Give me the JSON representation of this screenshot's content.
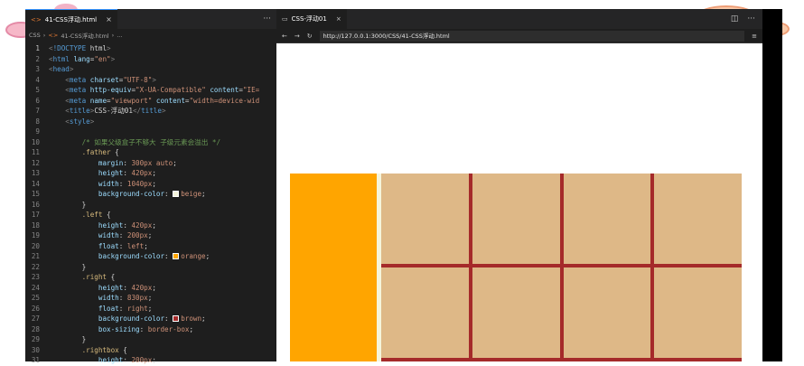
{
  "editor": {
    "tab_label": "41-CSS浮动.html",
    "breadcrumb": [
      "CSS",
      "41-CSS浮动.html",
      "..."
    ],
    "more": "···",
    "close": "×",
    "active_line": 1,
    "lines": [
      {
        "n": 1,
        "t": [
          [
            "pun",
            "<"
          ],
          [
            "kw",
            "!DOCTYPE"
          ],
          [
            "txt",
            " html"
          ],
          [
            "pun",
            ">"
          ]
        ]
      },
      {
        "n": 2,
        "t": [
          [
            "pun",
            "<"
          ],
          [
            "tag",
            "html"
          ],
          [
            "at",
            " lang"
          ],
          [
            "txt",
            "="
          ],
          [
            "str",
            "\"en\""
          ],
          [
            "pun",
            ">"
          ]
        ]
      },
      {
        "n": 3,
        "t": [
          [
            "pun",
            "<"
          ],
          [
            "tag",
            "head"
          ],
          [
            "pun",
            ">"
          ]
        ]
      },
      {
        "n": 4,
        "t": [
          [
            "txt",
            "    "
          ],
          [
            "pun",
            "<"
          ],
          [
            "tag",
            "meta"
          ],
          [
            "at",
            " charset"
          ],
          [
            "txt",
            "="
          ],
          [
            "str",
            "\"UTF-8\""
          ],
          [
            "pun",
            ">"
          ]
        ]
      },
      {
        "n": 5,
        "t": [
          [
            "txt",
            "    "
          ],
          [
            "pun",
            "<"
          ],
          [
            "tag",
            "meta"
          ],
          [
            "at",
            " http-equiv"
          ],
          [
            "txt",
            "="
          ],
          [
            "str",
            "\"X-UA-Compatible\""
          ],
          [
            "at",
            " content"
          ],
          [
            "txt",
            "="
          ],
          [
            "str",
            "\"IE="
          ]
        ]
      },
      {
        "n": 6,
        "t": [
          [
            "txt",
            "    "
          ],
          [
            "pun",
            "<"
          ],
          [
            "tag",
            "meta"
          ],
          [
            "at",
            " name"
          ],
          [
            "txt",
            "="
          ],
          [
            "str",
            "\"viewport\""
          ],
          [
            "at",
            " content"
          ],
          [
            "txt",
            "="
          ],
          [
            "str",
            "\"width=device-wid"
          ]
        ]
      },
      {
        "n": 7,
        "t": [
          [
            "txt",
            "    "
          ],
          [
            "pun",
            "<"
          ],
          [
            "tag",
            "title"
          ],
          [
            "pun",
            ">"
          ],
          [
            "txt",
            "CSS-浮动01"
          ],
          [
            "pun",
            "</"
          ],
          [
            "tag",
            "title"
          ],
          [
            "pun",
            ">"
          ]
        ]
      },
      {
        "n": 8,
        "t": [
          [
            "txt",
            "    "
          ],
          [
            "pun",
            "<"
          ],
          [
            "tag",
            "style"
          ],
          [
            "pun",
            ">"
          ]
        ]
      },
      {
        "n": 9,
        "t": []
      },
      {
        "n": 10,
        "t": [
          [
            "txt",
            "        "
          ],
          [
            "cmt",
            "/* 如果父级盒子不够大 子级元素会溢出 */"
          ]
        ]
      },
      {
        "n": 11,
        "t": [
          [
            "txt",
            "        "
          ],
          [
            "sel",
            ".father"
          ],
          [
            "txt",
            " {"
          ]
        ]
      },
      {
        "n": 12,
        "t": [
          [
            "txt",
            "            "
          ],
          [
            "prop",
            "margin"
          ],
          [
            "txt",
            ": "
          ],
          [
            "val",
            "300px auto"
          ],
          [
            "txt",
            ";"
          ]
        ]
      },
      {
        "n": 13,
        "t": [
          [
            "txt",
            "            "
          ],
          [
            "prop",
            "height"
          ],
          [
            "txt",
            ": "
          ],
          [
            "val",
            "420px"
          ],
          [
            "txt",
            ";"
          ]
        ]
      },
      {
        "n": 14,
        "t": [
          [
            "txt",
            "            "
          ],
          [
            "prop",
            "width"
          ],
          [
            "txt",
            ": "
          ],
          [
            "val",
            "1040px"
          ],
          [
            "txt",
            ";"
          ]
        ]
      },
      {
        "n": 15,
        "t": [
          [
            "txt",
            "            "
          ],
          [
            "prop",
            "background-color"
          ],
          [
            "txt",
            ": "
          ],
          [
            "sw",
            "#f5f5dc"
          ],
          [
            "val",
            "beige"
          ],
          [
            "txt",
            ";"
          ]
        ]
      },
      {
        "n": 16,
        "t": [
          [
            "txt",
            "        }"
          ]
        ]
      },
      {
        "n": 17,
        "t": [
          [
            "txt",
            "        "
          ],
          [
            "sel",
            ".left"
          ],
          [
            "txt",
            " {"
          ]
        ]
      },
      {
        "n": 18,
        "t": [
          [
            "txt",
            "            "
          ],
          [
            "prop",
            "height"
          ],
          [
            "txt",
            ": "
          ],
          [
            "val",
            "420px"
          ],
          [
            "txt",
            ";"
          ]
        ]
      },
      {
        "n": 19,
        "t": [
          [
            "txt",
            "            "
          ],
          [
            "prop",
            "width"
          ],
          [
            "txt",
            ": "
          ],
          [
            "val",
            "200px"
          ],
          [
            "txt",
            ";"
          ]
        ]
      },
      {
        "n": 20,
        "t": [
          [
            "txt",
            "            "
          ],
          [
            "prop",
            "float"
          ],
          [
            "txt",
            ": "
          ],
          [
            "val",
            "left"
          ],
          [
            "txt",
            ";"
          ]
        ]
      },
      {
        "n": 21,
        "t": [
          [
            "txt",
            "            "
          ],
          [
            "prop",
            "background-color"
          ],
          [
            "txt",
            ": "
          ],
          [
            "sw",
            "#ffa500"
          ],
          [
            "val",
            "orange"
          ],
          [
            "txt",
            ";"
          ]
        ]
      },
      {
        "n": 22,
        "t": [
          [
            "txt",
            "        }"
          ]
        ]
      },
      {
        "n": 23,
        "t": [
          [
            "txt",
            "        "
          ],
          [
            "sel",
            ".right"
          ],
          [
            "txt",
            " {"
          ]
        ]
      },
      {
        "n": 24,
        "t": [
          [
            "txt",
            "            "
          ],
          [
            "prop",
            "height"
          ],
          [
            "txt",
            ": "
          ],
          [
            "val",
            "420px"
          ],
          [
            "txt",
            ";"
          ]
        ]
      },
      {
        "n": 25,
        "t": [
          [
            "txt",
            "            "
          ],
          [
            "prop",
            "width"
          ],
          [
            "txt",
            ": "
          ],
          [
            "val",
            "830px"
          ],
          [
            "txt",
            ";"
          ]
        ]
      },
      {
        "n": 26,
        "t": [
          [
            "txt",
            "            "
          ],
          [
            "prop",
            "float"
          ],
          [
            "txt",
            ": "
          ],
          [
            "val",
            "right"
          ],
          [
            "txt",
            ";"
          ]
        ]
      },
      {
        "n": 27,
        "t": [
          [
            "txt",
            "            "
          ],
          [
            "prop",
            "background-color"
          ],
          [
            "txt",
            ": "
          ],
          [
            "sw",
            "#a52a2a"
          ],
          [
            "val",
            "brown"
          ],
          [
            "txt",
            ";"
          ]
        ]
      },
      {
        "n": 28,
        "t": [
          [
            "txt",
            "            "
          ],
          [
            "prop",
            "box-sizing"
          ],
          [
            "txt",
            ": "
          ],
          [
            "val",
            "border-box"
          ],
          [
            "txt",
            ";"
          ]
        ]
      },
      {
        "n": 29,
        "t": [
          [
            "txt",
            "        }"
          ]
        ]
      },
      {
        "n": 30,
        "t": [
          [
            "txt",
            "        "
          ],
          [
            "sel",
            ".rightbox"
          ],
          [
            "txt",
            " {"
          ]
        ]
      },
      {
        "n": 31,
        "t": [
          [
            "txt",
            "            "
          ],
          [
            "prop",
            "height"
          ],
          [
            "txt",
            ": "
          ],
          [
            "val",
            "200px"
          ],
          [
            "txt",
            ";"
          ]
        ]
      }
    ]
  },
  "browser": {
    "tab_label": "CSS-浮动01",
    "close": "×",
    "url": "http://127.0.0.1:3000/CSS/41-CSS浮动.html",
    "nav": {
      "back": "←",
      "forward": "→",
      "reload": "↻"
    },
    "split_icon": "◫",
    "more": "···",
    "menu_icon": "≡"
  },
  "page": {
    "father_color": "#f5f5dc",
    "left_color": "#ffa500",
    "right_color": "#a52a2a",
    "cell_color": "#deb887",
    "grid": {
      "rows": 2,
      "cols": 4
    }
  }
}
